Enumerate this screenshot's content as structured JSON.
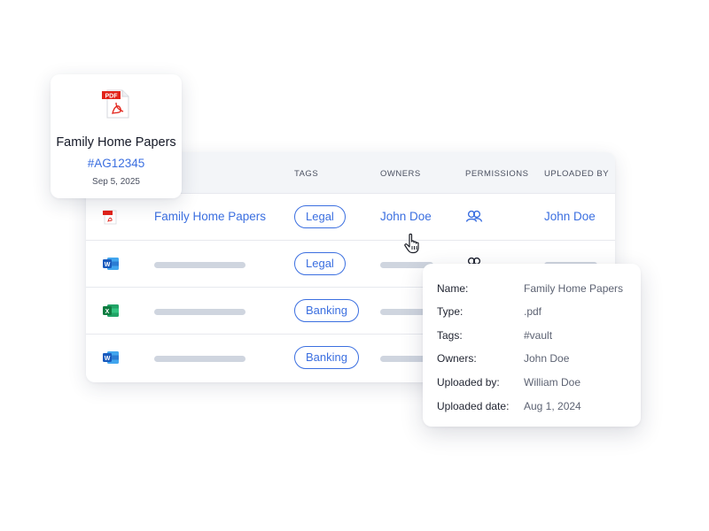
{
  "file_card": {
    "icon": "pdf-file-icon",
    "title": "Family Home Papers",
    "code": "#AG12345",
    "date": "Sep 5, 2025"
  },
  "table": {
    "headers": {
      "tags": "TAGS",
      "owners": "OWNERS",
      "permissions": "PERMISSIONS",
      "uploaded_by": "UPLOADED BY"
    },
    "rows": [
      {
        "file_icon": "pdf-file-icon",
        "name": "Family Home Papers",
        "tag": "Legal",
        "owner": "John Doe",
        "permission_icon": "users-icon",
        "uploaded_by": "John Doe"
      },
      {
        "file_icon": "word-file-icon",
        "name": "",
        "tag": "Legal",
        "owner": "",
        "permission_icon": "users-icon",
        "uploaded_by": ""
      },
      {
        "file_icon": "excel-file-icon",
        "name": "",
        "tag": "Banking",
        "owner": "",
        "permission_icon": "",
        "uploaded_by": ""
      },
      {
        "file_icon": "word-file-icon",
        "name": "",
        "tag": "Banking",
        "owner": "",
        "permission_icon": "",
        "uploaded_by": ""
      }
    ]
  },
  "details": {
    "name_label": "Name:",
    "name_value": "Family Home Papers",
    "type_label": "Type:",
    "type_value": ".pdf",
    "tags_label": "Tags:",
    "tags_value": "#vault",
    "owners_label": "Owners:",
    "owners_value": "John Doe",
    "uploaded_by_label": "Uploaded by:",
    "uploaded_by_value": "William Doe",
    "uploaded_date_label": "Uploaded date:",
    "uploaded_date_value": "Aug 1, 2024"
  },
  "colors": {
    "accent": "#3b6fe0",
    "pdf_red": "#e2231a",
    "word_blue": "#185abd",
    "excel_green": "#107c41",
    "placeholder_bar": "#cfd5df",
    "header_bg": "#f3f5f8"
  }
}
